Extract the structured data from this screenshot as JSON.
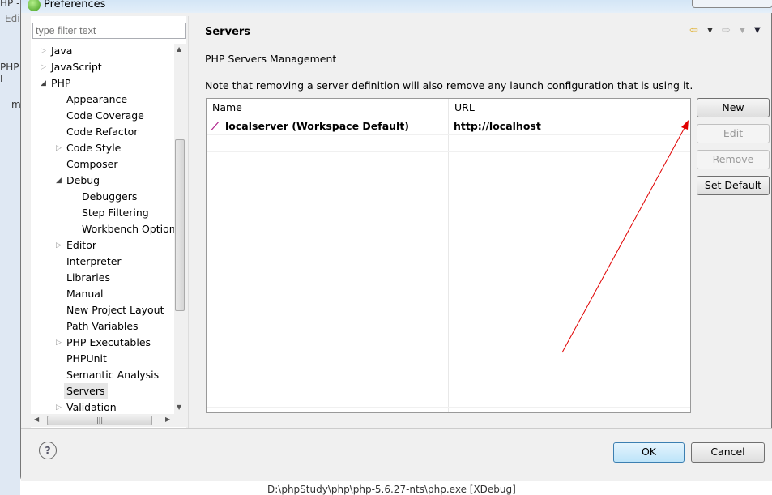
{
  "window": {
    "title": "Preferences"
  },
  "background": {
    "fragments": [
      "HP -",
      "Edi",
      "PHP I",
      "m"
    ],
    "console_line": "D:\\phpStudy\\php\\php-5.6.27-nts\\php.exe [XDebug]"
  },
  "filter": {
    "placeholder": "type filter text"
  },
  "tree": {
    "items": [
      {
        "label": "Java",
        "level": 0,
        "twisty": "collapsed"
      },
      {
        "label": "JavaScript",
        "level": 0,
        "twisty": "collapsed"
      },
      {
        "label": "PHP",
        "level": 0,
        "twisty": "expanded"
      },
      {
        "label": "Appearance",
        "level": 1,
        "twisty": ""
      },
      {
        "label": "Code Coverage",
        "level": 1,
        "twisty": ""
      },
      {
        "label": "Code Refactor",
        "level": 1,
        "twisty": ""
      },
      {
        "label": "Code Style",
        "level": 1,
        "twisty": "collapsed"
      },
      {
        "label": "Composer",
        "level": 1,
        "twisty": ""
      },
      {
        "label": "Debug",
        "level": 1,
        "twisty": "expanded"
      },
      {
        "label": "Debuggers",
        "level": 2,
        "twisty": ""
      },
      {
        "label": "Step Filtering",
        "level": 2,
        "twisty": ""
      },
      {
        "label": "Workbench Options",
        "level": 2,
        "twisty": ""
      },
      {
        "label": "Editor",
        "level": 1,
        "twisty": "collapsed"
      },
      {
        "label": "Interpreter",
        "level": 1,
        "twisty": ""
      },
      {
        "label": "Libraries",
        "level": 1,
        "twisty": ""
      },
      {
        "label": "Manual",
        "level": 1,
        "twisty": ""
      },
      {
        "label": "New Project Layout",
        "level": 1,
        "twisty": ""
      },
      {
        "label": "Path Variables",
        "level": 1,
        "twisty": ""
      },
      {
        "label": "PHP Executables",
        "level": 1,
        "twisty": "collapsed"
      },
      {
        "label": "PHPUnit",
        "level": 1,
        "twisty": ""
      },
      {
        "label": "Semantic Analysis",
        "level": 1,
        "twisty": ""
      },
      {
        "label": "Servers",
        "level": 1,
        "twisty": "",
        "selected": true
      },
      {
        "label": "Validation",
        "level": 1,
        "twisty": "collapsed"
      }
    ]
  },
  "page": {
    "title": "Servers",
    "description": "PHP Servers Management",
    "note": "Note that removing a server definition will also remove any launch configuration that is using it.",
    "table": {
      "columns": [
        "Name",
        "URL"
      ],
      "rows": [
        {
          "name": "localserver (Workspace Default)",
          "url": "http://localhost"
        }
      ]
    },
    "buttons": {
      "new": "New",
      "edit": "Edit",
      "remove": "Remove",
      "set_default": "Set Default"
    }
  },
  "footer": {
    "ok": "OK",
    "cancel": "Cancel",
    "help": "?"
  },
  "colors": {
    "annotation_arrow": "#e00000",
    "ok_border": "#3c7fb1"
  }
}
